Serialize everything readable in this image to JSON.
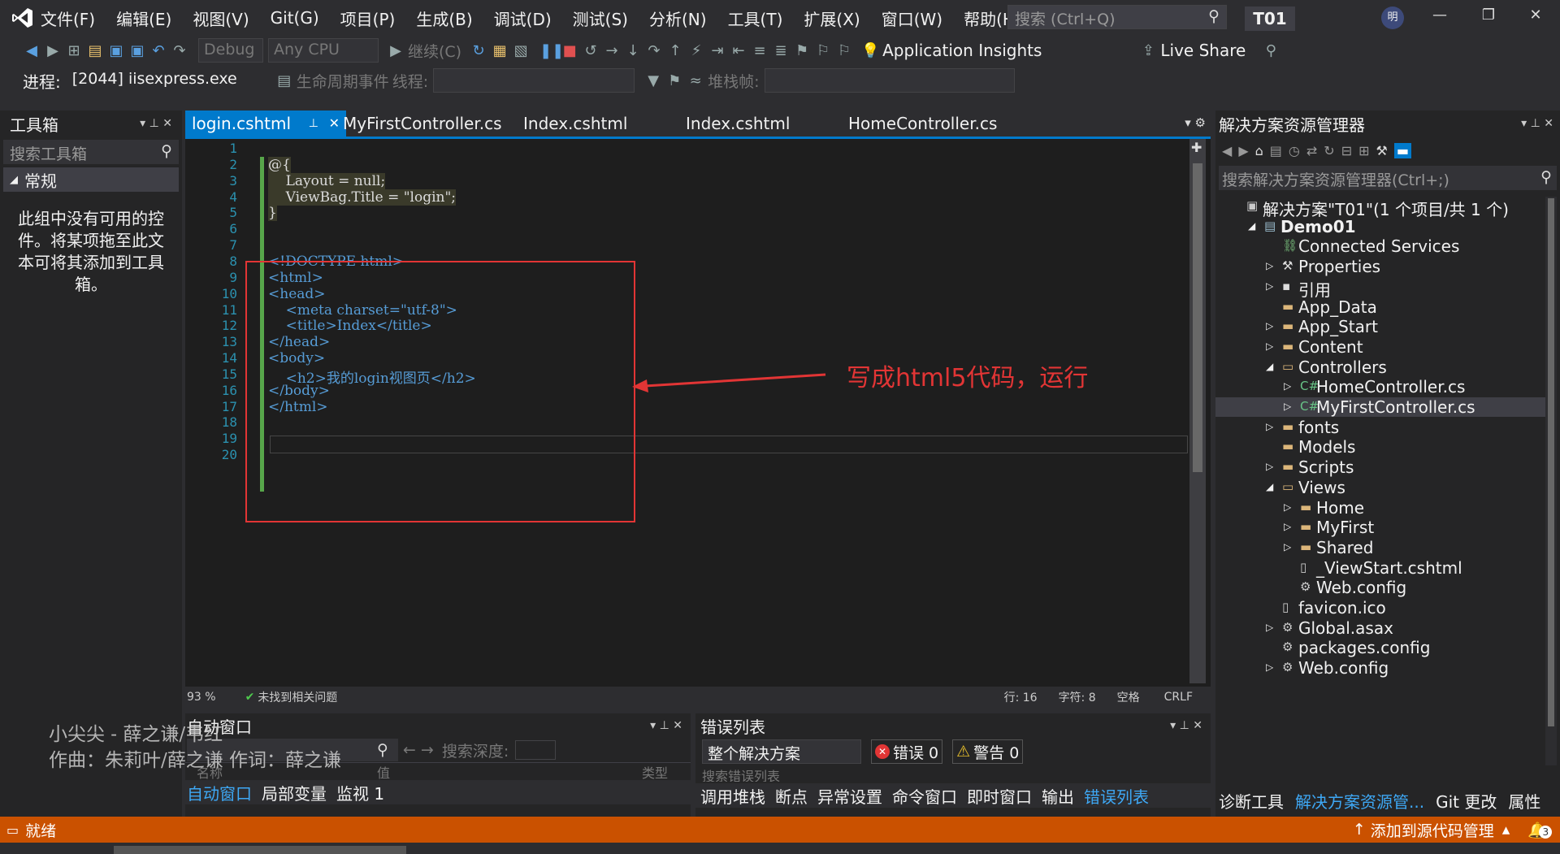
{
  "menu": {
    "items": [
      "文件(F)",
      "编辑(E)",
      "视图(V)",
      "Git(G)",
      "项目(P)",
      "生成(B)",
      "调试(D)",
      "测试(S)",
      "分析(N)",
      "工具(T)",
      "扩展(X)",
      "窗口(W)",
      "帮助(H)"
    ],
    "search_placeholder": "搜索 (Ctrl+Q)",
    "solution_badge": "T01",
    "avatar_text": "明"
  },
  "toolbar": {
    "config": "Debug",
    "platform": "Any CPU",
    "continue_label": "继续(C)",
    "app_insights": "Application Insights",
    "live_share": "Live Share"
  },
  "process_bar": {
    "process_label": "进程:",
    "process_value": "[2044] iisexpress.exe",
    "lifecycle_label": "生命周期事件",
    "thread_label": "线程:",
    "stackframe_label": "堆栈帧:"
  },
  "toolbox": {
    "title": "工具箱",
    "search_placeholder": "搜索工具箱",
    "group": "常规",
    "empty_text": "此组中没有可用的控件。将某项拖至此文本可将其添加到工具箱。"
  },
  "tabs": [
    {
      "label": "login.cshtml",
      "active": true
    },
    {
      "label": "MyFirstController.cs"
    },
    {
      "label": "Index.cshtml"
    },
    {
      "label": "Index.cshtml"
    },
    {
      "label": "HomeController.cs"
    }
  ],
  "code_lines": [
    "",
    "@{",
    "    Layout = null;",
    "    ViewBag.Title = \"login\";",
    "}",
    "",
    "",
    "<!DOCTYPE html>",
    "<html>",
    "<head>",
    "    <meta charset=\"utf-8\">",
    "    <title>Index</title>",
    "</head>",
    "<body>",
    "    <h2>我的login视图页</h2>",
    "</body>",
    "</html>",
    "",
    "",
    ""
  ],
  "annotation": "写成html5代码，运行",
  "editor_status": {
    "zoom": "93 %",
    "issues": "未找到相关问题",
    "line": "行: 16",
    "char": "字符: 8",
    "space": "空格",
    "eol": "CRLF"
  },
  "solution_explorer": {
    "title": "解决方案资源管理器",
    "search_placeholder": "搜索解决方案资源管理器(Ctrl+;)",
    "items": [
      {
        "label": "解决方案\"T01\"(1 个项目/共 1 个)",
        "level": 0,
        "icon": "solution-icon",
        "arrow": ""
      },
      {
        "label": "Demo01",
        "level": 1,
        "icon": "project-icon",
        "arrow": "open",
        "bold": true
      },
      {
        "label": "Connected Services",
        "level": 2,
        "icon": "connected-icon",
        "arrow": ""
      },
      {
        "label": "Properties",
        "level": 2,
        "icon": "wrench-icon",
        "arrow": "closed"
      },
      {
        "label": "引用",
        "level": 2,
        "icon": "reference-icon",
        "arrow": "closed"
      },
      {
        "label": "App_Data",
        "level": 2,
        "icon": "folder-icon",
        "arrow": ""
      },
      {
        "label": "App_Start",
        "level": 2,
        "icon": "folder-icon",
        "arrow": "closed"
      },
      {
        "label": "Content",
        "level": 2,
        "icon": "folder-icon",
        "arrow": "closed"
      },
      {
        "label": "Controllers",
        "level": 2,
        "icon": "folder-open-icon",
        "arrow": "open"
      },
      {
        "label": "HomeController.cs",
        "level": 3,
        "icon": "csharp-icon",
        "arrow": "closed"
      },
      {
        "label": "MyFirstController.cs",
        "level": 3,
        "icon": "csharp-icon",
        "arrow": "closed",
        "selected": true
      },
      {
        "label": "fonts",
        "level": 2,
        "icon": "folder-icon",
        "arrow": "closed"
      },
      {
        "label": "Models",
        "level": 2,
        "icon": "folder-icon",
        "arrow": ""
      },
      {
        "label": "Scripts",
        "level": 2,
        "icon": "folder-icon",
        "arrow": "closed"
      },
      {
        "label": "Views",
        "level": 2,
        "icon": "folder-open-icon",
        "arrow": "open"
      },
      {
        "label": "Home",
        "level": 3,
        "icon": "folder-icon",
        "arrow": "closed"
      },
      {
        "label": "MyFirst",
        "level": 3,
        "icon": "folder-icon",
        "arrow": "closed"
      },
      {
        "label": "Shared",
        "level": 3,
        "icon": "folder-icon",
        "arrow": "closed"
      },
      {
        "label": "_ViewStart.cshtml",
        "level": 3,
        "icon": "file-icon",
        "arrow": ""
      },
      {
        "label": "Web.config",
        "level": 3,
        "icon": "config-icon",
        "arrow": ""
      },
      {
        "label": "favicon.ico",
        "level": 2,
        "icon": "file-icon",
        "arrow": ""
      },
      {
        "label": "Global.asax",
        "level": 2,
        "icon": "config-icon",
        "arrow": "closed"
      },
      {
        "label": "packages.config",
        "level": 2,
        "icon": "config-icon",
        "arrow": ""
      },
      {
        "label": "Web.config",
        "level": 2,
        "icon": "config-icon",
        "arrow": "closed"
      }
    ]
  },
  "autos_panel": {
    "title": "自动窗口",
    "search_depth": "搜索深度:",
    "col_name": "名称",
    "col_value": "值",
    "col_type": "类型",
    "tabs": [
      "自动窗口",
      "局部变量",
      "监视 1"
    ]
  },
  "error_panel": {
    "title": "错误列表",
    "scope": "整个解决方案",
    "errors": "错误 0",
    "warnings": "警告 0",
    "search": "搜索错误列表",
    "tabs": [
      "调用堆栈",
      "断点",
      "异常设置",
      "命令窗口",
      "即时窗口",
      "输出",
      "错误列表"
    ]
  },
  "right_bottom_tabs": [
    "诊断工具",
    "解决方案资源管...",
    "Git 更改",
    "属性"
  ],
  "lyrics": {
    "line1": "小尖尖 - 薛之谦/韦红",
    "line2": "作曲：朱莉叶/薛之谦 作词：薛之谦"
  },
  "status": {
    "ready": "就绪",
    "source_control": "添加到源代码管理",
    "notifications": "3"
  }
}
